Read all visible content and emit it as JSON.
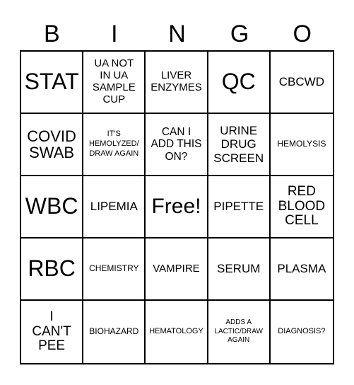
{
  "header": [
    "B",
    "I",
    "N",
    "G",
    "O"
  ],
  "cells": [
    [
      "STAT",
      "UA NOT IN UA SAMPLE CUP",
      "LIVER ENZYMES",
      "QC",
      "CBCWD"
    ],
    [
      "COVID SWAB",
      "IT'S HEMOLYZED/ DRAW AGAIN",
      "CAN I ADD THIS ON?",
      "URINE DRUG SCREEN",
      "HEMOLYSIS"
    ],
    [
      "WBC",
      "LIPEMIA",
      "Free!",
      "PIPETTE",
      "RED BLOOD CELL"
    ],
    [
      "RBC",
      "CHEMISTRY",
      "VAMPIRE",
      "SERUM",
      "PLASMA"
    ],
    [
      "I CAN'T PEE",
      "BIOHAZARD",
      "HEMATOLOGY",
      "ADDS A LACTIC/DRAW AGAIN",
      "DIAGNOSIS?"
    ]
  ]
}
